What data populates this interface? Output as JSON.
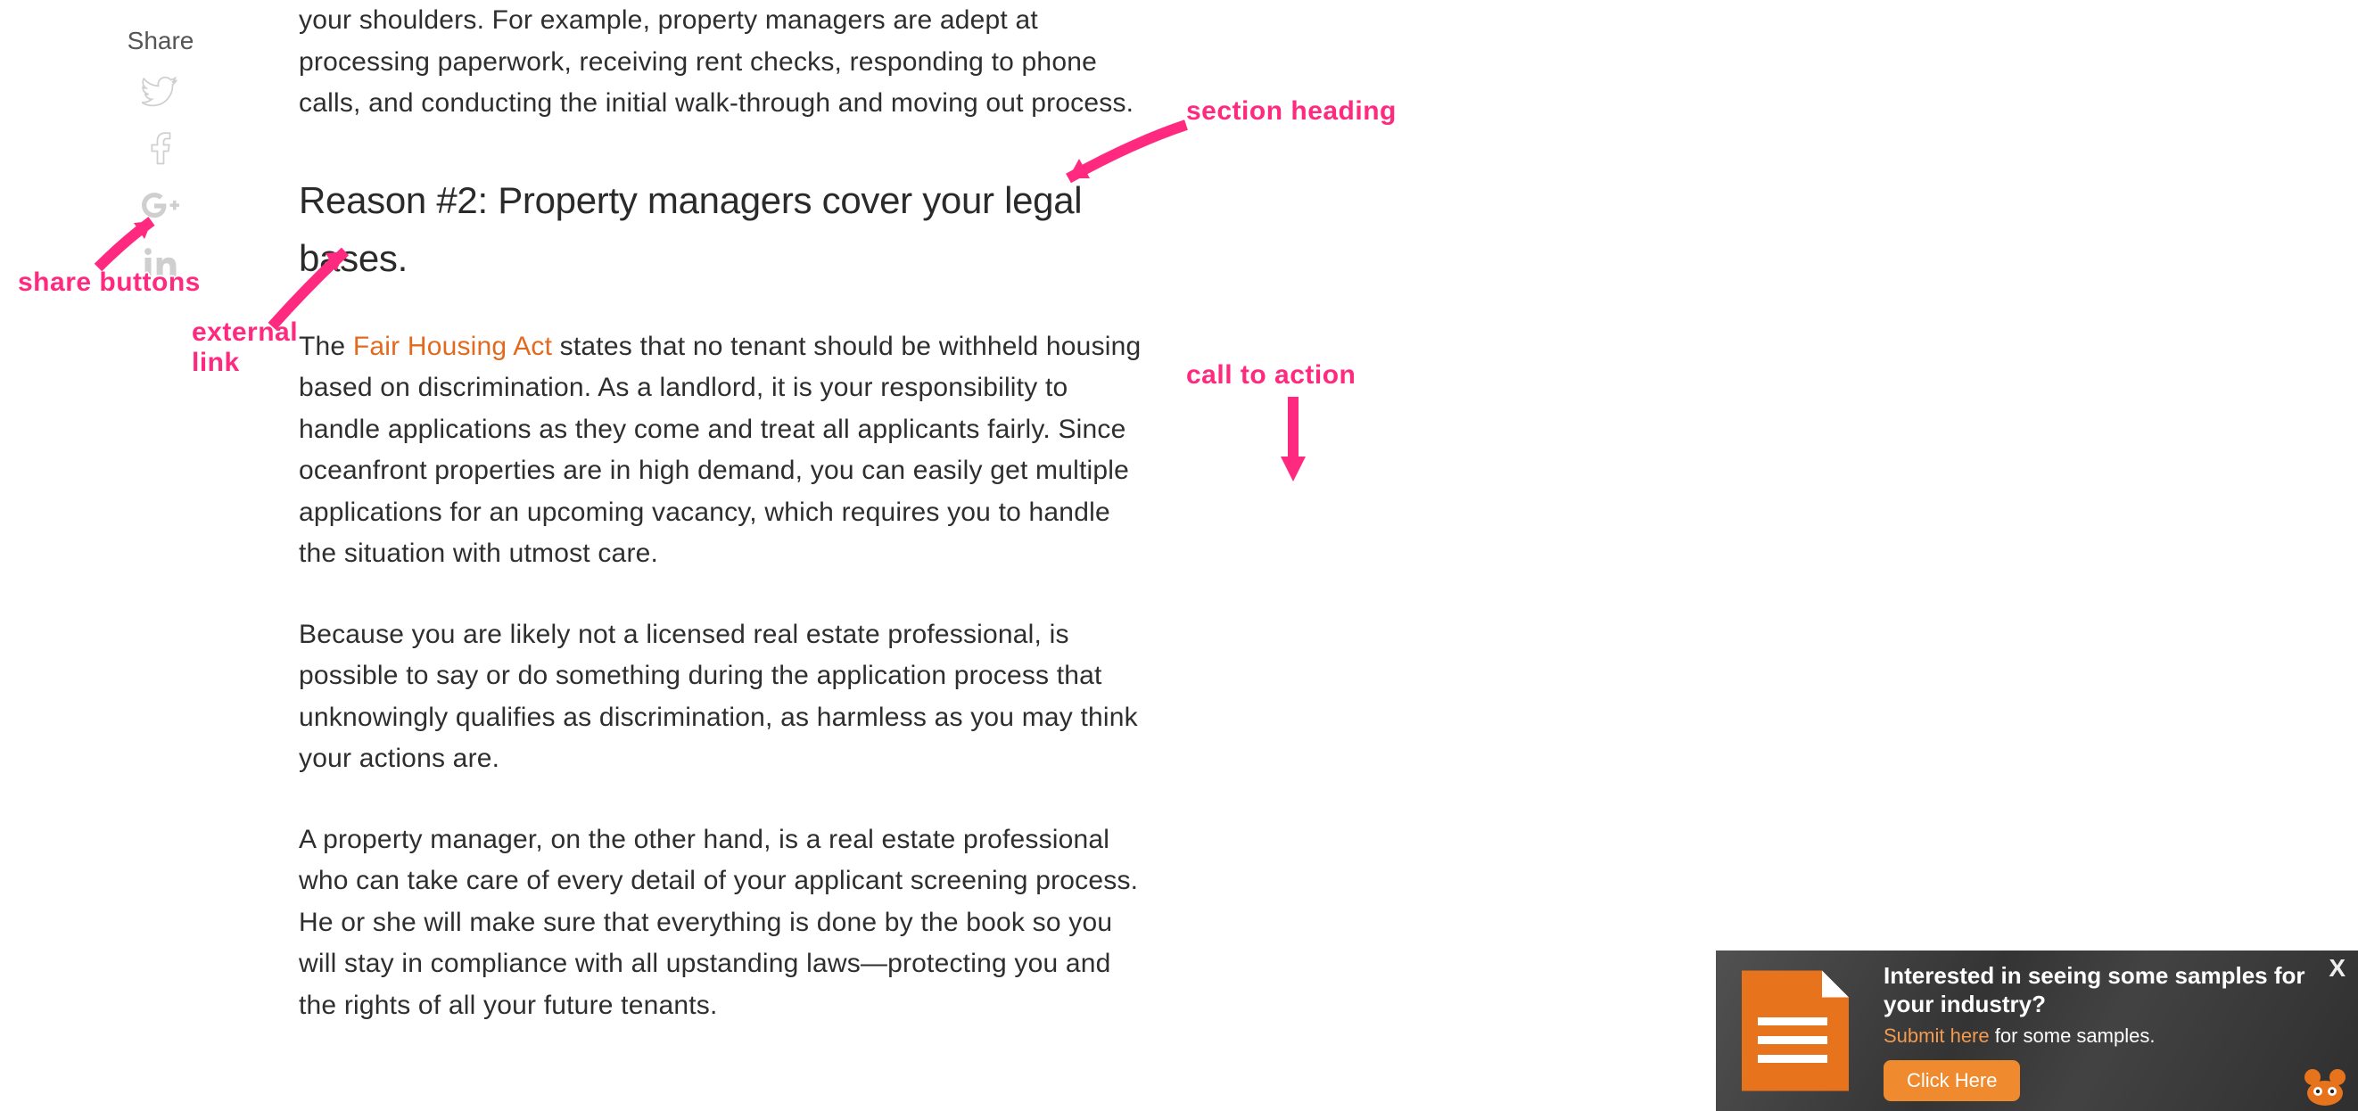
{
  "share": {
    "label": "Share",
    "icons": [
      "twitter",
      "facebook",
      "google-plus",
      "linkedin"
    ]
  },
  "article": {
    "p1": "your shoulders. For example, property managers are adept at processing paperwork, receiving rent checks, responding to phone calls, and conducting the initial walk-through and moving out process.",
    "h2": "Reason #2: Property managers cover your legal bases.",
    "p2a": "The ",
    "p2_link": "Fair Housing Act",
    "p2b": " states that no tenant should be withheld housing based on discrimination. As a landlord, it is your responsibility to handle applications as they come and treat all applicants fairly. Since oceanfront properties are in high demand, you can easily get multiple applications for an upcoming vacancy, which requires you to handle the situation with utmost care.",
    "p3": "Because you are likely not a licensed real estate professional, is possible to say or do something during the application process that unknowingly qualifies as discrimination, as harmless as you may think your actions are.",
    "p4": "A property manager, on the other hand, is a real estate professional who can take care of every detail of your applicant screening process. He or she will make sure that everything is done by the book so you will stay in compliance with all upstanding laws—protecting you and the rights of all your future tenants."
  },
  "cta": {
    "headline": "Interested in seeing some samples for your industry?",
    "subtext_link": "Submit here",
    "subtext_rest": " for some samples.",
    "button": "Click Here",
    "close": "X"
  },
  "annotations": {
    "share_buttons": "share buttons",
    "external_link": "external\nlink",
    "section_heading": "section heading",
    "call_to_action": "call to action"
  }
}
